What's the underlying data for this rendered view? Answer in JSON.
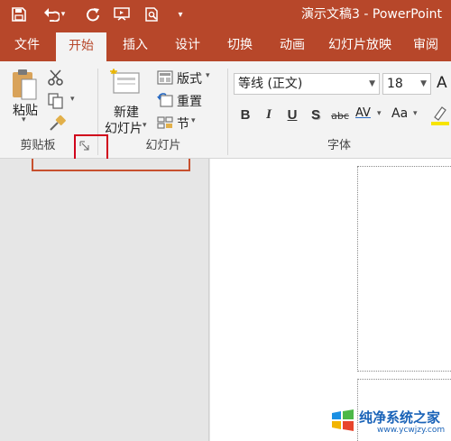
{
  "window": {
    "title": "演示文稿3 - PowerPoint"
  },
  "tabs": [
    "文件",
    "开始",
    "插入",
    "设计",
    "切换",
    "动画",
    "幻灯片放映",
    "审阅"
  ],
  "ribbon": {
    "clipboard": {
      "paste_label": "粘贴",
      "group_label": "剪贴板"
    },
    "slides": {
      "new_slide_line1": "新建",
      "new_slide_line2": "幻灯片",
      "layout_label": "版式",
      "reset_label": "重置",
      "section_label": "节",
      "group_label": "幻灯片"
    },
    "font": {
      "font_name": "等线 (正文)",
      "font_size": "18",
      "bold": "B",
      "italic": "I",
      "underline": "U",
      "shadow": "S",
      "strikethrough": "abc",
      "char_spacing": "AV",
      "change_case": "Aa",
      "grow_font": "A",
      "group_label": "字体"
    }
  },
  "watermark": {
    "title": "纯净系统之家",
    "url": "www.ycwjzy.com"
  },
  "colors": {
    "accent": "#b7472a",
    "highlight": "#d0021b"
  }
}
